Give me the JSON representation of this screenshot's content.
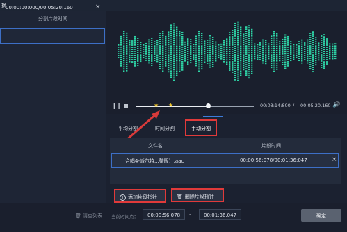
{
  "window": {
    "title": "换"
  },
  "segments": {
    "header": "分割片段时间",
    "items": [
      {
        "range": "00:00:00:000/00:05:20:160"
      }
    ],
    "clear_label": "清空列表"
  },
  "player": {
    "current_time": "00:03:14:800",
    "separator": "/",
    "total_time": "00:05.20.160",
    "progress": 0.61
  },
  "tabs": [
    {
      "label": "平均分割"
    },
    {
      "label": "时间分割"
    },
    {
      "label": "手动分割",
      "active": true
    }
  ],
  "table": {
    "columns": [
      "文件名",
      "片段时间"
    ],
    "rows": [
      {
        "file": "合唱4-派尔特...整版）.aac",
        "time": "00:00:56:078/00:01:36:047"
      }
    ]
  },
  "actions": {
    "add_label": "添加片段指针",
    "delete_label": "删除片段指针"
  },
  "bottom": {
    "current_label": "当前时间点：",
    "start": "00:00:56.078",
    "range_sep": "-",
    "end": "00:01:36.047",
    "confirm": "确定"
  },
  "colors": {
    "accent": "#3d7bd9",
    "highlight": "#e03a3a",
    "wave": "#2ed3a6",
    "marker": "#f1c62b"
  }
}
